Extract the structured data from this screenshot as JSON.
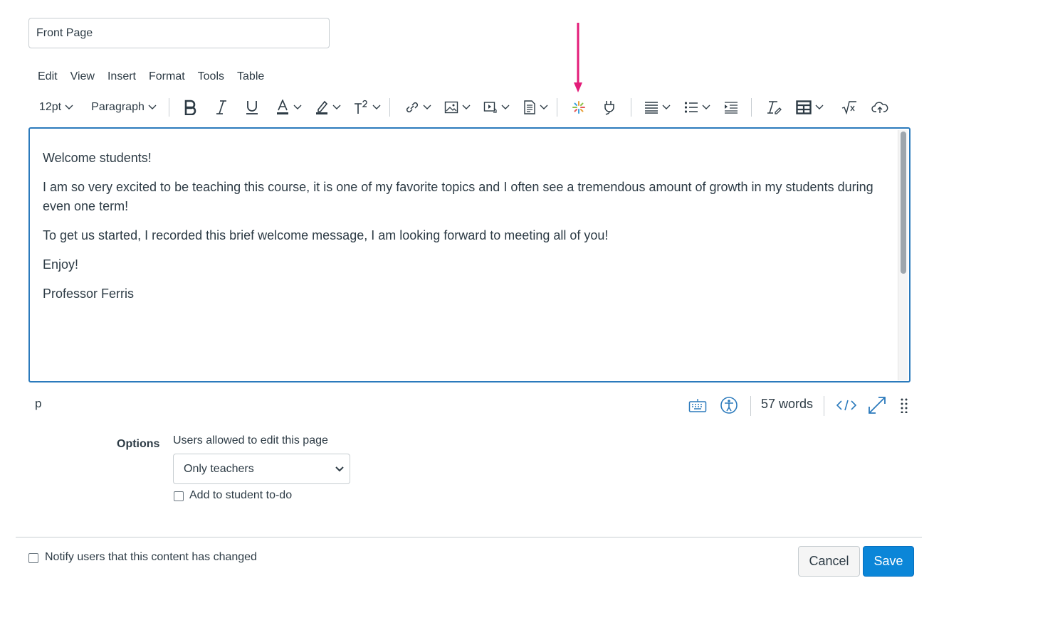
{
  "title_field": {
    "value": "Front Page"
  },
  "menubar": {
    "items": [
      {
        "label": "Edit"
      },
      {
        "label": "View"
      },
      {
        "label": "Insert"
      },
      {
        "label": "Format"
      },
      {
        "label": "Tools"
      },
      {
        "label": "Table"
      }
    ]
  },
  "toolbar": {
    "font_size": "12pt",
    "block_format": "Paragraph",
    "icons": [
      "bold-icon",
      "italic-icon",
      "underline-icon",
      "text-color-icon",
      "highlight-color-icon",
      "superscript-icon",
      "link-icon",
      "image-icon",
      "media-icon",
      "document-icon",
      "apps-icon",
      "plugin-icon",
      "align-icon",
      "list-icon",
      "indent-icon",
      "clear-formatting-icon",
      "table-icon",
      "equation-icon",
      "cloud-upload-icon"
    ]
  },
  "annotation": {
    "arrow_color": "#e31c79"
  },
  "editor": {
    "paragraphs": [
      "Welcome students!",
      "I am so very excited to be teaching this course, it is one of my favorite topics and I often see a tremendous amount of growth in my students during even one term!",
      "To get us started, I recorded this brief welcome message, I am looking forward to meeting all of you!",
      "Enjoy!",
      "Professor Ferris"
    ],
    "focus_border_color": "#2b7abc"
  },
  "statusbar": {
    "path": "p",
    "word_count": "57 words",
    "icons": [
      "keyboard-icon",
      "accessibility-icon",
      "html-view-icon",
      "fullscreen-icon",
      "resize-handle-icon"
    ]
  },
  "options": {
    "label": "Options",
    "users_label": "Users allowed to edit this page",
    "users_selected": "Only teachers",
    "todo_label": "Add to student to-do",
    "todo_checked": false
  },
  "footer": {
    "notify_label": "Notify users that this content has changed",
    "notify_checked": false,
    "cancel_label": "Cancel",
    "save_label": "Save",
    "save_color": "#0b86d8"
  }
}
